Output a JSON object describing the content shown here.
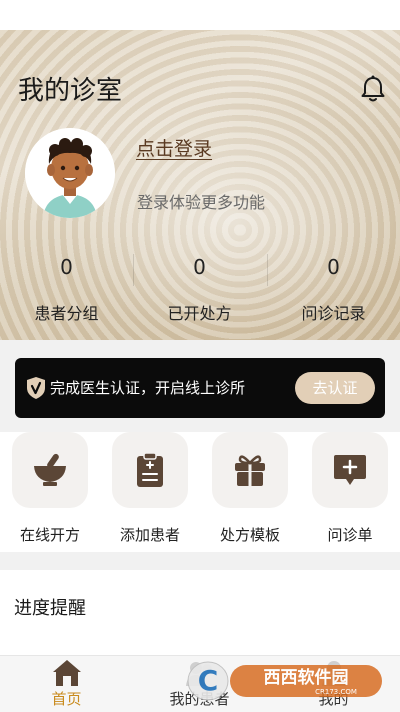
{
  "header": {
    "title": "我的诊室"
  },
  "profile": {
    "login_label": "点击登录",
    "login_hint": "登录体验更多功能"
  },
  "stats": [
    {
      "value": "0",
      "label": "患者分组"
    },
    {
      "value": "0",
      "label": "已开处方"
    },
    {
      "value": "0",
      "label": "问诊记录"
    }
  ],
  "certification": {
    "text": "完成医生认证，开启线上诊所",
    "button": "去认证"
  },
  "quick_actions": [
    {
      "label": "在线开方",
      "icon": "mortar-bowl-icon"
    },
    {
      "label": "添加患者",
      "icon": "clipboard-icon"
    },
    {
      "label": "处方模板",
      "icon": "gift-box-icon"
    },
    {
      "label": "问诊单",
      "icon": "add-message-icon"
    }
  ],
  "progress": {
    "title": "进度提醒"
  },
  "tabbar": [
    {
      "label": "首页",
      "icon": "home-icon",
      "active": true
    },
    {
      "label": "我的患者",
      "icon": "patients-icon",
      "active": false
    },
    {
      "label": "我的",
      "icon": "profile-icon",
      "active": false
    }
  ],
  "watermark": {
    "text": "西西软件园",
    "sub": "CR173.COM",
    "badge": "C"
  },
  "colors": {
    "accent": "#c98b1d",
    "brand_brown": "#5a3a22",
    "icon_brown": "#5b4636",
    "cert_button": "#e2cfb7"
  }
}
